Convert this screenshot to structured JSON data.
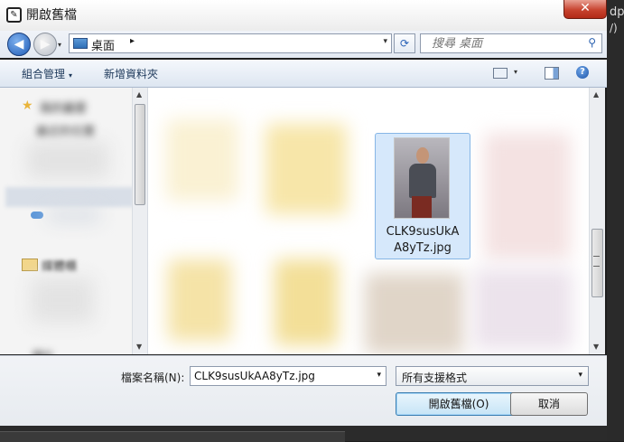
{
  "window": {
    "title": "開啟舊檔",
    "close_glyph": "✕",
    "app_icon_glyph": "✎",
    "side_text_1": "dp",
    "side_text_2": "/)"
  },
  "navigation": {
    "back_glyph": "◀",
    "forward_glyph": "▶",
    "history_glyph": "▾",
    "address": "桌面",
    "address_arrow": "▸",
    "address_drop": "▾",
    "refresh_glyph": "⟳",
    "search_placeholder": "搜尋 桌面",
    "search_glyph": "⚲"
  },
  "toolbar": {
    "organize": "組合管理",
    "new_folder": "新增資料夾",
    "drop_glyph": "▾",
    "help_glyph": "?"
  },
  "nav_pane": {
    "favorites": "我的最愛",
    "recent_places": "最近的位置",
    "media_libraries": "媒體櫃",
    "pictures": "圖片",
    "scroll_up": "▲",
    "scroll_down": "▼"
  },
  "files": {
    "selected_name": "CLK9susUkAA8yTz.jpg",
    "selected_name_line1": "CLK9susUkA",
    "selected_name_line2": "A8yTz.jpg",
    "scroll_up": "▲",
    "scroll_down": "▼"
  },
  "footer": {
    "filename_label": "檔案名稱(N):",
    "filename_value": "CLK9susUkAA8yTz.jpg",
    "filetype": "所有支援格式",
    "drop_glyph": "▾",
    "open": "開啟舊檔(O)",
    "cancel": "取消"
  },
  "colors": {
    "accent": "#1f5cb7",
    "selection": "#d6e8fb",
    "close": "#c7432f"
  }
}
